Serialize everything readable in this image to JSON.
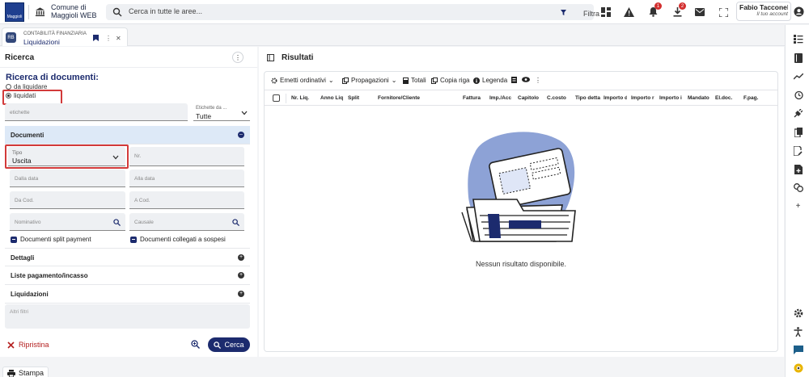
{
  "header": {
    "logo_text": "Maggioli",
    "municipality_line1": "Comune di",
    "municipality_line2": "Maggioli WEB",
    "search_placeholder": "Cerca in tutte le aree...",
    "filter_label": "Filtra",
    "notifications_count": "1",
    "downloads_count": "2",
    "user_name": "Fabio Tacconelli",
    "user_account_label": "Il tuo account"
  },
  "tab": {
    "module": "CONTABILITÀ FINANZIARIA",
    "title": "Liquidazioni",
    "icon_text": "RB"
  },
  "left_panel": {
    "title": "Ricerca",
    "heading": "Ricerca di documenti:",
    "radio_options": [
      "da liquidare",
      "liquidati"
    ],
    "selected_radio": "liquidati",
    "etichette_placeholder": "etichette",
    "etichette_select": {
      "label": "Etichette da ...",
      "value": "Tutte"
    },
    "sections": {
      "documenti": "Documenti",
      "dettagli": "Dettagli",
      "liste": "Liste pagamento/incasso",
      "liquidazioni": "Liquidazioni"
    },
    "tipo": {
      "label": "Tipo",
      "value": "Uscita"
    },
    "placeholders": {
      "nr": "Nr.",
      "dalla_data": "Dalla data",
      "alla_data": "Alla data",
      "da_cod": "Da Cod.",
      "a_cod": "A Cod.",
      "nominativo": "Nominativo",
      "causale": "Causale",
      "altri_filtri": "Altri filtri"
    },
    "checkboxes": {
      "split": "Documenti split payment",
      "sospesi": "Documenti collegati a sospesi"
    },
    "reset_label": "Ripristina",
    "search_label": "Cerca"
  },
  "right_panel": {
    "title": "Risultati",
    "toolbar": {
      "emetti": "Emetti ordinativi",
      "propagazioni": "Propagazioni",
      "totali": "Totali",
      "copia": "Copia riga",
      "legenda": "Legenda"
    },
    "columns": [
      "Nr. Liq.",
      "Anno Liq",
      "Split",
      "Fornitore/Cliente",
      "Fattura",
      "Imp./Acc",
      "Capitolo",
      "C.costo",
      "Tipo detta",
      "Importo d",
      "Importo r",
      "Importo i",
      "Mandato",
      "El.doc.",
      "F.pag."
    ],
    "empty_message": "Nessun risultato disponibile."
  },
  "footer": {
    "print_label": "Stampa"
  },
  "colors": {
    "primary": "#1c2b6e",
    "accent_red": "#d23a3a",
    "section_active": "#dde9f7"
  }
}
